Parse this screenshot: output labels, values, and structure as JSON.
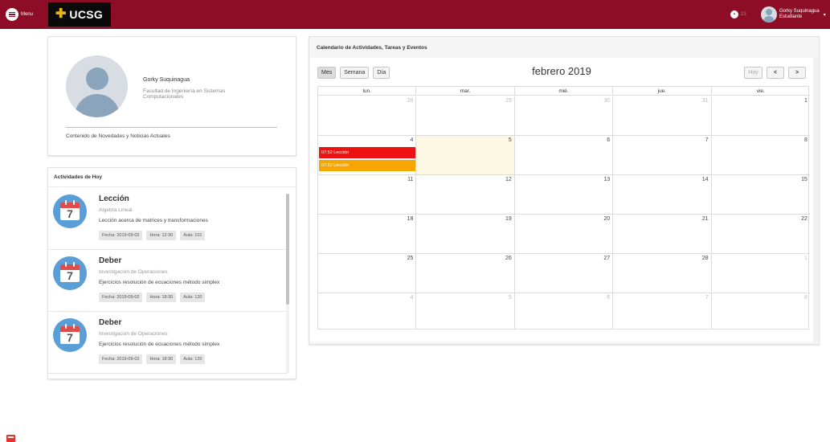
{
  "topbar": {
    "menu_label": "Menu",
    "brand_text": "UCSG",
    "notification_count": "23",
    "user_name": "Gorky Suquinagua",
    "user_role": "Estudiante"
  },
  "profile": {
    "name": "Gorky Suquinagua",
    "faculty": "Facultad de Ingeniería en Sistemas Computacionales",
    "news_label": "Contenido de Novedades y Noticias Actuales"
  },
  "activities": {
    "header": "Actividades de Hoy",
    "items": [
      {
        "title": "Lección",
        "subject": "Algebra Lineal",
        "description": "Lección acerca de matrices y transformaciones",
        "date": "Fecha: 2019-09-02",
        "time": "Hora: 12:30",
        "room": "Aula: 101",
        "icon_day": "7"
      },
      {
        "title": "Deber",
        "subject": "Investigacion de Operaciones",
        "description": "Ejercicios resolución de ecuaciones método simplex",
        "date": "Fecha: 2019-09-02",
        "time": "Hora: 18:30",
        "room": "Aula: 120",
        "icon_day": "7"
      },
      {
        "title": "Deber",
        "subject": "Investigacion de Operaciones",
        "description": "Ejercicios resolución de ecuaciones método simplex",
        "date": "Fecha: 2019-09-02",
        "time": "Hora: 18:30",
        "room": "Aula: 120",
        "icon_day": "7"
      }
    ]
  },
  "calendar": {
    "title": "Calendario de Actividades, Tareas y Eventos",
    "views": {
      "month": "Mes",
      "week": "Semana",
      "day": "Día"
    },
    "month_title": "febrero 2019",
    "today_label": "Hoy",
    "prev_label": "<",
    "next_label": ">",
    "days_of_week": [
      "lun.",
      "mar.",
      "mié.",
      "jue.",
      "vie."
    ],
    "weeks": [
      [
        "28",
        "29",
        "30",
        "31",
        "1"
      ],
      [
        "4",
        "5",
        "6",
        "7",
        "8"
      ],
      [
        "11",
        "12",
        "13",
        "14",
        "15"
      ],
      [
        "18",
        "19",
        "20",
        "21",
        "22"
      ],
      [
        "25",
        "26",
        "27",
        "28",
        "1"
      ],
      [
        "4",
        "5",
        "6",
        "7",
        "8"
      ]
    ],
    "events": [
      {
        "label": "07:52 Lección",
        "color": "#ee1111"
      },
      {
        "label": "07:52 Lección",
        "color": "#f7a600"
      }
    ]
  },
  "colors": {
    "topbar": "#8c0d25",
    "brand_bg": "#0a0a0a",
    "today_highlight": "#fcf8e3"
  }
}
